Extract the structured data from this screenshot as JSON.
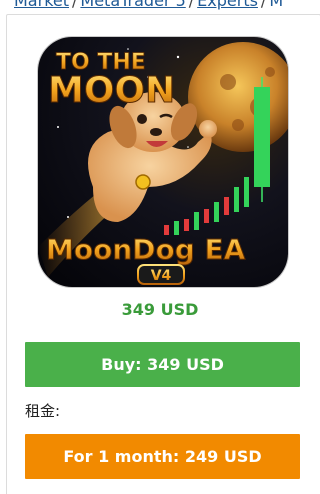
{
  "breadcrumb": {
    "items": [
      "Market",
      "MetaTrader 5",
      "Experts"
    ],
    "separator": "/",
    "trailing": "M"
  },
  "product": {
    "image": {
      "headline_top": "TO THE",
      "headline_moon": "MOON",
      "brand": "MoonDog EA",
      "version": "V4"
    },
    "price": "349 USD"
  },
  "actions": {
    "buy_label": "Buy: 349 USD",
    "rent_label": "租金:",
    "rent_month_label": "For 1 month: 249 USD"
  },
  "colors": {
    "link": "#1f5a96",
    "price": "#3a9b3a",
    "buy_button": "#4ab04a",
    "rent_button": "#f28a00"
  }
}
